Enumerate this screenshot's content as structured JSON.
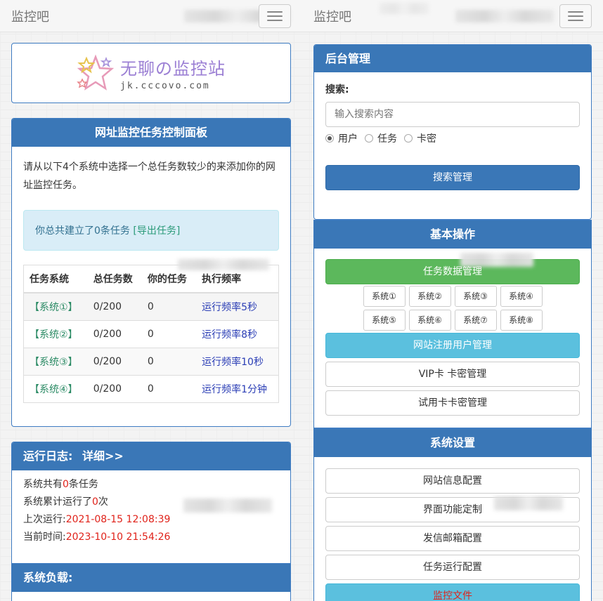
{
  "left": {
    "brand": "监控吧",
    "logo": {
      "title": "无聊の监控站",
      "domain": "jk.cccovo.com"
    },
    "task_panel": {
      "title": "网址监控任务控制面板",
      "intro": "请从以下4个系统中选择一个总任务数较少的来添加你的网址监控任务。",
      "info_text": "你总共建立了0条任务",
      "export_link": "[导出任务]",
      "columns": [
        "任务系统",
        "总任务数",
        "你的任务",
        "执行频率"
      ],
      "rows": [
        {
          "system": "【系统①】",
          "total": "0/200",
          "mine": "0",
          "freq": "运行频率5秒"
        },
        {
          "system": "【系统②】",
          "total": "0/200",
          "mine": "0",
          "freq": "运行频率8秒"
        },
        {
          "system": "【系统③】",
          "total": "0/200",
          "mine": "0",
          "freq": "运行频率10秒"
        },
        {
          "system": "【系统④】",
          "total": "0/200",
          "mine": "0",
          "freq": "运行频率1分钟"
        }
      ]
    },
    "log_panel": {
      "title": "运行日志:",
      "detail_link": "详细>>",
      "l1_pre": "系统共有",
      "l1_val": "0",
      "l1_post": "条任务",
      "l2_pre": "系统累计运行了",
      "l2_val": "0",
      "l2_post": "次",
      "l3_pre": "上次运行:",
      "l3_val": "2021-08-15 12:08:39",
      "l4_pre": "当前时间:",
      "l4_val": "2023-10-10 21:54:26"
    },
    "load_panel": {
      "title": "系统负载:"
    }
  },
  "right": {
    "brand": "监控吧",
    "admin_panel": {
      "title": "后台管理",
      "search_label": "搜索:",
      "search_placeholder": "输入搜索内容",
      "radio_user": "用户",
      "radio_task": "任务",
      "radio_card": "卡密",
      "search_button": "搜索管理"
    },
    "basic_panel": {
      "title": "基本操作",
      "task_data_button": "任务数据管理",
      "systems": [
        "系统①",
        "系统②",
        "系统③",
        "系统④",
        "系统⑤",
        "系统⑥",
        "系统⑦",
        "系统⑧"
      ],
      "users_button": "网站注册用户管理",
      "vip_button": "VIP卡 卡密管理",
      "trial_button": "试用卡卡密管理"
    },
    "settings_panel": {
      "title": "系统设置",
      "site_info_button": "网站信息配置",
      "ui_button": "界面功能定制",
      "mail_button": "发信邮箱配置",
      "task_run_button": "任务运行配置",
      "monitor_file_button": "监控文件"
    }
  },
  "colors": {
    "primary": "#3a77b7",
    "success": "#5cb85c",
    "info": "#5bc0de",
    "danger": "#e0221a",
    "link_green": "#2a8a64",
    "link_blue": "#2a3db5"
  }
}
